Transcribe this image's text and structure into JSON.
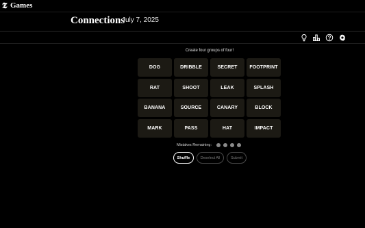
{
  "brand": {
    "logo_glyph": "𝕿",
    "name": "Games"
  },
  "header": {
    "title": "Connections",
    "date": "July 7, 2025"
  },
  "toolbar": {
    "icons": [
      "lightbulb-icon",
      "leaderboard-icon",
      "help-icon",
      "gear-icon"
    ]
  },
  "board": {
    "instruction": "Create four groups of four!",
    "tiles": [
      "DOG",
      "DRIBBLE",
      "SECRET",
      "FOOTPRINT",
      "RAT",
      "SHOOT",
      "LEAK",
      "SPLASH",
      "BANANA",
      "SOURCE",
      "CANARY",
      "BLOCK",
      "MARK",
      "PASS",
      "HAT",
      "IMPACT"
    ],
    "tile_color": "#1c1a14"
  },
  "mistakes": {
    "label": "Mistakes Remaining:",
    "remaining": 4
  },
  "actions": {
    "shuffle_label": "Shuffle",
    "deselect_label": "Deselect All",
    "submit_label": "Submit"
  }
}
